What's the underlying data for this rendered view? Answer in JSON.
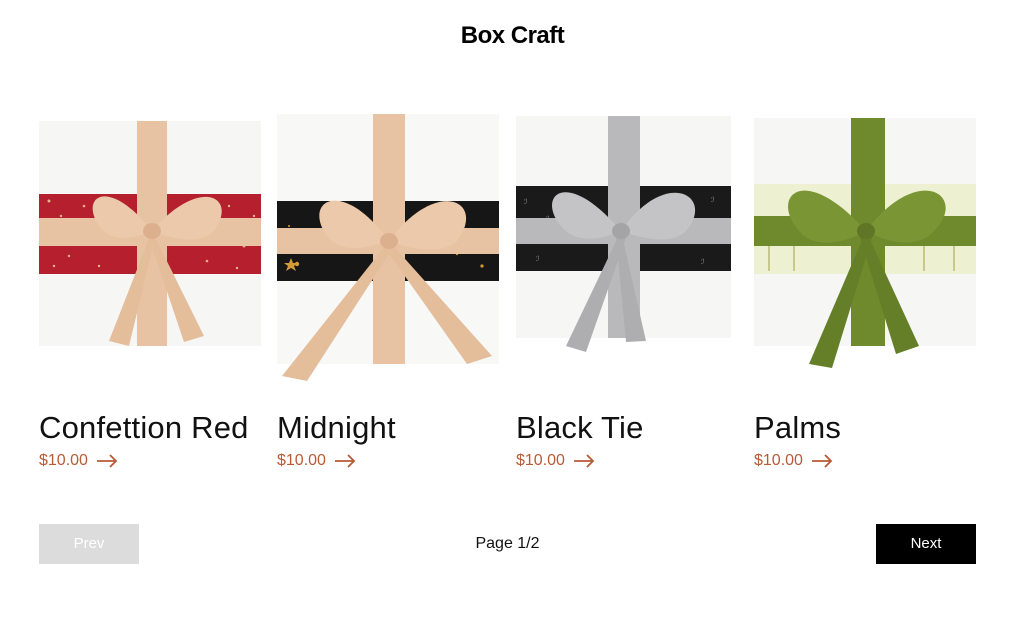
{
  "header": {
    "title": "Box Craft"
  },
  "products": [
    {
      "name": "Confettion Red",
      "price": "$10.00",
      "band_color": "#b51f2e",
      "ribbon_color": "#e8c3a3",
      "image": "red-confetti-gift-box"
    },
    {
      "name": "Midnight",
      "price": "$10.00",
      "band_color": "#161616",
      "ribbon_color": "#e8c3a3",
      "image": "midnight-star-gift-box"
    },
    {
      "name": "Black Tie",
      "price": "$10.00",
      "band_color": "#1a1a1a",
      "ribbon_color": "#b9b9bb",
      "image": "black-tie-gift-box"
    },
    {
      "name": "Palms",
      "price": "$10.00",
      "band_color": "#eef0d2",
      "ribbon_color": "#6f8a2c",
      "image": "palms-gift-box"
    }
  ],
  "pagination": {
    "prev_label": "Prev",
    "next_label": "Next",
    "page_label": "Page 1/2"
  },
  "colors": {
    "price": "#b85a36",
    "next_bg": "#000000",
    "prev_bg": "#dcdcdc"
  }
}
